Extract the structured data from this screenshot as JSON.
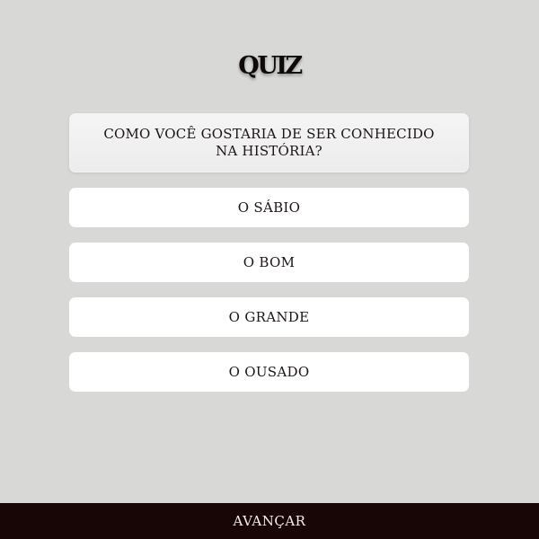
{
  "header": {
    "title": "QUIZ"
  },
  "question": {
    "text": "COMO VOCÊ GOSTARIA DE SER CONHECIDO NA HISTÓRIA?"
  },
  "options": [
    {
      "label": "O SÁBIO"
    },
    {
      "label": "O BOM"
    },
    {
      "label": "O GRANDE"
    },
    {
      "label": "O OUSADO"
    }
  ],
  "footer": {
    "next_label": "AVANÇAR"
  },
  "colors": {
    "background": "#d8d8d7",
    "option_background": "#ffffff",
    "footer_background": "#170605",
    "text": "#1c1514"
  }
}
